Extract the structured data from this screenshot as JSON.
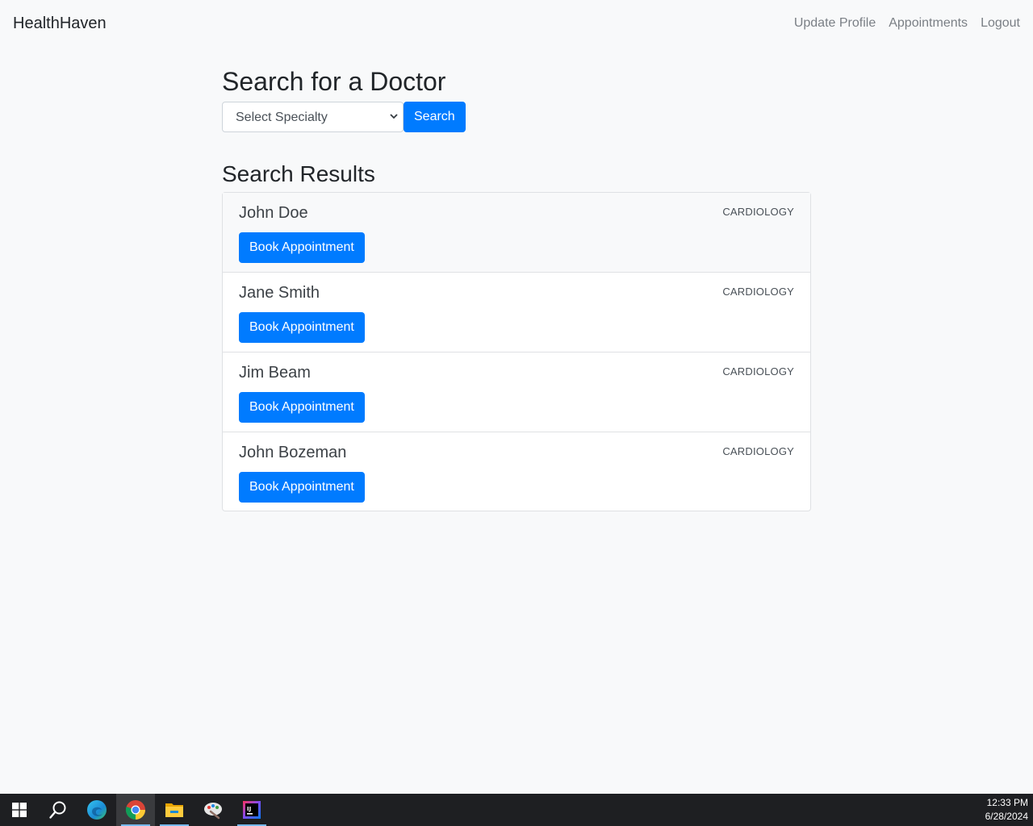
{
  "navbar": {
    "brand": "HealthHaven",
    "links": [
      "Update Profile",
      "Appointments",
      "Logout"
    ]
  },
  "search": {
    "title": "Search for a Doctor",
    "select_placeholder": "Select Specialty",
    "button_label": "Search"
  },
  "results": {
    "title": "Search Results",
    "items": [
      {
        "name": "John Doe",
        "specialty": "CARDIOLOGY",
        "button": "Book Appointment"
      },
      {
        "name": "Jane Smith",
        "specialty": "CARDIOLOGY",
        "button": "Book Appointment"
      },
      {
        "name": "Jim Beam",
        "specialty": "CARDIOLOGY",
        "button": "Book Appointment"
      },
      {
        "name": "John Bozeman",
        "specialty": "CARDIOLOGY",
        "button": "Book Appointment"
      }
    ]
  },
  "taskbar": {
    "icons": [
      "windows-start-icon",
      "search-icon",
      "edge-icon",
      "chrome-icon",
      "file-explorer-icon",
      "paint-icon",
      "intellij-icon"
    ],
    "time": "12:33 PM",
    "date": "6/28/2024"
  },
  "colors": {
    "primary": "#007bff",
    "background": "#f8f9fa",
    "taskbar": "#1e1f22"
  }
}
